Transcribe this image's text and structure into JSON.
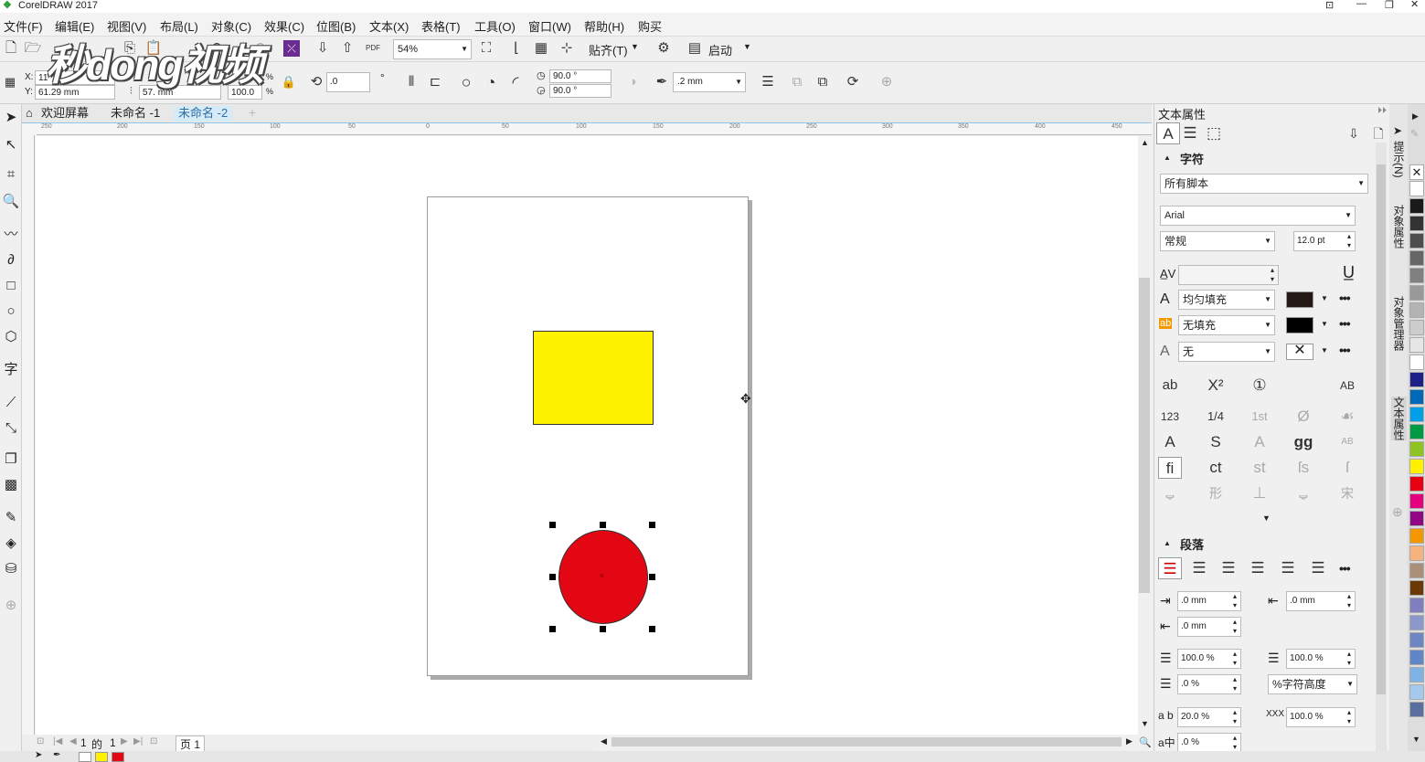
{
  "app": {
    "title": "CorelDRAW 2017"
  },
  "menu": [
    "文件(F)",
    "编辑(E)",
    "视图(V)",
    "布局(L)",
    "对象(C)",
    "效果(C)",
    "位图(B)",
    "文本(X)",
    "表格(T)",
    "工具(O)",
    "窗口(W)",
    "帮助(H)",
    "购买"
  ],
  "toolbar": {
    "zoom": "54%",
    "snap_label": "贴齐(T)",
    "launch_label": "启动",
    "pdf_label": "PDF"
  },
  "propbar": {
    "x_label": "X:",
    "x_value": "11",
    "y_label": "Y:",
    "y_value": "61.29 mm",
    "h_value": "57.",
    "h_unit": "mm",
    "scale_h": "100.0",
    "pct": "%",
    "rotation": ".0",
    "angle_start": "90.0 °",
    "angle_end": "90.0 °",
    "outline_width": ".2 mm"
  },
  "watermark": "秒dong视频",
  "doc_tabs": [
    "欢迎屏幕",
    "未命名 -1",
    "未命名 -2"
  ],
  "ruler_h": [
    "250",
    "200",
    "150",
    "100",
    "50",
    "0",
    "50",
    "100",
    "150",
    "200",
    "250",
    "300",
    "350",
    "400",
    "450"
  ],
  "status": {
    "page_current": "1",
    "page_of": "的",
    "page_total": "1",
    "page_tab": "页 1"
  },
  "panel": {
    "title": "文本属性",
    "char_section": "字符",
    "script": "所有脚本",
    "font": "Arial",
    "style": "常规",
    "size": "12.0 pt",
    "fill_type": "均匀填充",
    "bg_fill": "无填充",
    "outline": "无",
    "para_section": "段落",
    "indent_left": ".0 mm",
    "indent_first": ".0 mm",
    "indent_right": ".0 mm",
    "line_spacing": "100.0 %",
    "before_para": "100.0 %",
    "after_para": ".0 %",
    "spacing_unit": "%字符高度",
    "char_spacing": "20.0 %",
    "word_spacing": "100.0 %",
    "lang_spacing": ".0 %"
  },
  "vtabs": [
    "提示(N)",
    "对象属性",
    "对象管理器",
    "文本属性"
  ],
  "colors": {
    "rect_fill": "#fff200",
    "circle_fill": "#e30613",
    "text_fill": "#231815",
    "bg_fill": "#000000",
    "palette": [
      "#ffffff",
      "#1a1a1a",
      "#333333",
      "#4d4d4d",
      "#666666",
      "#808080",
      "#999999",
      "#b3b3b3",
      "#cccccc",
      "#e6e6e6",
      "#ffffff",
      "#1d2088",
      "#0068b7",
      "#00a0e9",
      "#009944",
      "#8fc31f",
      "#fff100",
      "#e60012",
      "#e4007f",
      "#920783",
      "#f39800",
      "#f6b37f",
      "#a98f78",
      "#6a3906",
      "#7f7fbf",
      "#8c97cb",
      "#6d85c3",
      "#5f86c6",
      "#7fb2e5",
      "#a3c9ec",
      "#5a6f9e"
    ]
  }
}
